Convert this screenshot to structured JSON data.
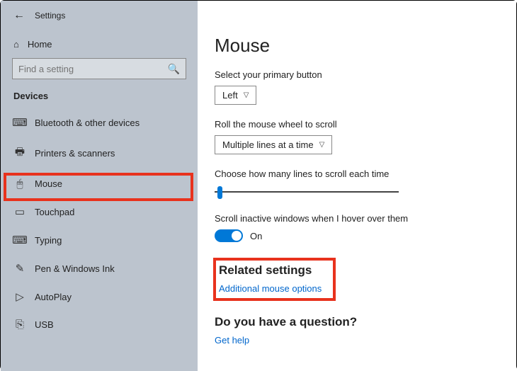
{
  "window": {
    "app_title": "Settings"
  },
  "sidebar": {
    "home": "Home",
    "search_placeholder": "Find a setting",
    "section": "Devices",
    "items": [
      {
        "label": "Bluetooth & other devices"
      },
      {
        "label": "Printers & scanners"
      },
      {
        "label": "Mouse"
      },
      {
        "label": "Touchpad"
      },
      {
        "label": "Typing"
      },
      {
        "label": "Pen & Windows Ink"
      },
      {
        "label": "AutoPlay"
      },
      {
        "label": "USB"
      }
    ]
  },
  "main": {
    "title": "Mouse",
    "primary_button_label": "Select your primary button",
    "primary_button_value": "Left",
    "scroll_label": "Roll the mouse wheel to scroll",
    "scroll_value": "Multiple lines at a time",
    "lines_label": "Choose how many lines to scroll each time",
    "inactive_label": "Scroll inactive windows when I hover over them",
    "inactive_state": "On",
    "related_heading": "Related settings",
    "related_link": "Additional mouse options",
    "question_heading": "Do you have a question?",
    "question_link": "Get help"
  }
}
